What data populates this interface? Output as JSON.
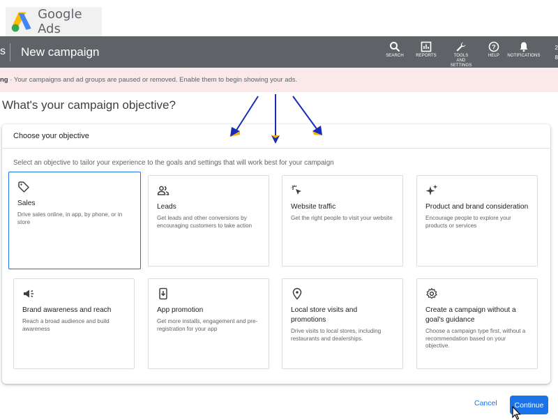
{
  "brand": {
    "logo_text": "Google Ads"
  },
  "header": {
    "back_fragment": "s",
    "title": "New campaign",
    "nav": [
      {
        "icon": "search-icon",
        "label": "SEARCH"
      },
      {
        "icon": "reports-icon",
        "label": "REPORTS"
      },
      {
        "icon": "wrench-icon",
        "label": "TOOLS AND SETTINGS"
      },
      {
        "icon": "help-icon",
        "label": "HELP"
      },
      {
        "icon": "bell-icon",
        "label": "NOTIFICATIONS"
      }
    ],
    "account_fragment_1": "2",
    "account_fragment_2": "8"
  },
  "alert": {
    "bold": "ng",
    "text": " · Your campaigns and ad groups are paused or removed. Enable them to begin showing your ads."
  },
  "page": {
    "heading": "What's your campaign objective?"
  },
  "objective_card": {
    "title": "Choose your objective",
    "description": "Select an objective to tailor your experience to the goals and settings that will work best for your campaign",
    "tiles": [
      {
        "icon": "tag-icon",
        "name": "Sales",
        "desc": "Drive sales online, in app, by phone, or in store",
        "selected": true
      },
      {
        "icon": "people-icon",
        "name": "Leads",
        "desc": "Get leads and other conversions by encouraging customers to take action",
        "selected": false
      },
      {
        "icon": "click-icon",
        "name": "Website traffic",
        "desc": "Get the right people to visit your website",
        "selected": false
      },
      {
        "icon": "sparkle-icon",
        "name": "Product and brand consideration",
        "desc": "Encourage people to explore your products or services",
        "selected": false
      },
      {
        "icon": "megaphone-icon",
        "name": "Brand awareness and reach",
        "desc": "Reach a broad audience and build awareness",
        "selected": false
      },
      {
        "icon": "phone-app-icon",
        "name": "App promotion",
        "desc": "Get more installs, engagement and pre-registration for your app",
        "selected": false
      },
      {
        "icon": "location-pin-icon",
        "name": "Local store visits and promotions",
        "desc": "Drive visits to local stores, including restaurants and dealerships.",
        "selected": false
      },
      {
        "icon": "gear-icon",
        "name": "Create a campaign without a goal's guidance",
        "desc": "Choose a campaign type first, without a recommendation based on your objective.",
        "selected": false
      }
    ]
  },
  "footer": {
    "cancel_label": "Cancel",
    "continue_label": "Continue"
  },
  "colors": {
    "header_bg": "#5f6368",
    "alert_bg": "#fae9e8",
    "accent": "#1a73e8",
    "annotation_arrow": "#1a2bb8",
    "annotation_head": "#f4b400"
  }
}
